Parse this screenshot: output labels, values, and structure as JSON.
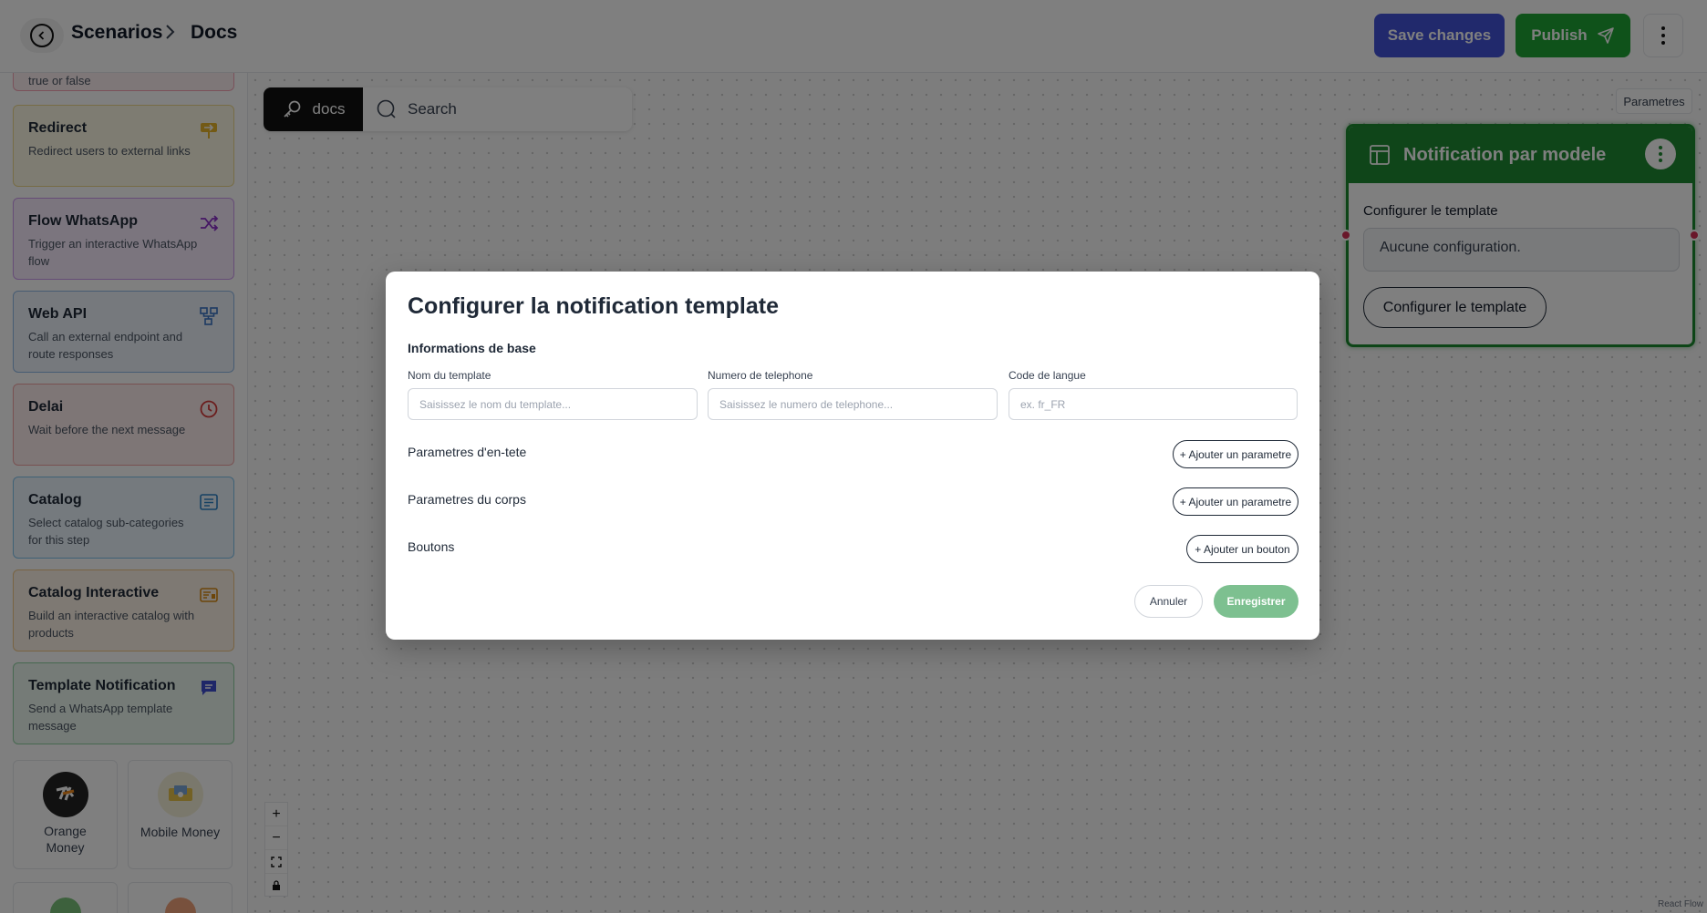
{
  "header": {
    "breadcrumb_root": "Scenarios",
    "breadcrumb_current": "Docs",
    "save_label": "Save changes",
    "publish_label": "Publish"
  },
  "sidebar": {
    "partial_card_desc": "true or false",
    "cards": [
      {
        "title": "Redirect",
        "desc": "Redirect users to external links",
        "icon": "redirect-sign-icon"
      },
      {
        "title": "Flow WhatsApp",
        "desc": "Trigger an interactive WhatsApp flow",
        "icon": "shuffle-icon"
      },
      {
        "title": "Web API",
        "desc": "Call an external endpoint and route responses",
        "icon": "network-icon"
      },
      {
        "title": "Delai",
        "desc": "Wait before the next message",
        "icon": "clock-icon"
      },
      {
        "title": "Catalog",
        "desc": "Select catalog sub-categories for this step",
        "icon": "list-icon"
      },
      {
        "title": "Catalog Interactive",
        "desc": "Build an interactive catalog with products",
        "icon": "catalog-card-icon"
      },
      {
        "title": "Template Notification",
        "desc": "Send a WhatsApp template message",
        "icon": "message-icon"
      }
    ],
    "payments": [
      {
        "label": "Orange Money"
      },
      {
        "label": "Mobile Money"
      }
    ]
  },
  "canvas": {
    "search_chip": "docs",
    "search_placeholder": "Search",
    "params_label": "Parametres",
    "attribution": "React Flow"
  },
  "node": {
    "title": "Notification par modele",
    "section_label": "Configurer le template",
    "field_value": "Aucune configuration.",
    "button_label": "Configurer le template"
  },
  "modal": {
    "title": "Configurer la notification template",
    "section_basic": "Informations de base",
    "fields": [
      {
        "label": "Nom du template",
        "placeholder": "Saisissez le nom du template..."
      },
      {
        "label": "Numero de telephone",
        "placeholder": "Saisissez le numero de telephone..."
      },
      {
        "label": "Code de langue",
        "placeholder": "ex. fr_FR"
      }
    ],
    "sections": [
      {
        "label": "Parametres d'en-tete",
        "button": "+ Ajouter un parametre"
      },
      {
        "label": "Parametres du corps",
        "button": "+ Ajouter un parametre"
      },
      {
        "label": "Boutons",
        "button": "+ Ajouter un bouton"
      }
    ],
    "cancel_label": "Annuler",
    "submit_label": "Enregistrer"
  },
  "colors": {
    "accent_blue": "#4353d9",
    "accent_green": "#1ea535",
    "node_green": "#1e8a33",
    "submit_green": "#7dc090"
  }
}
